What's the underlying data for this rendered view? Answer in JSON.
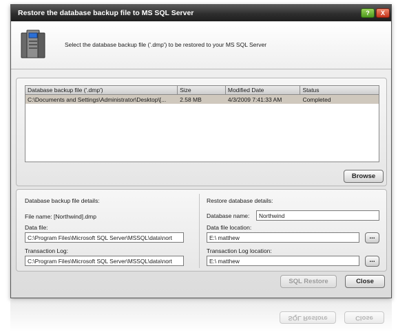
{
  "window": {
    "title": "Restore the database backup file to MS SQL Server",
    "help_glyph": "?",
    "close_glyph": "X"
  },
  "header": {
    "instruction": "Select the database backup file ('.dmp') to be restored to your MS SQL Server",
    "icon": "server-icon"
  },
  "file_list": {
    "columns": [
      "Database backup file ('.dmp')",
      "Size",
      "Modified Date",
      "Status"
    ],
    "rows": [
      {
        "file": "C:\\Documents and  Settings\\Administrator\\Desktop\\[...",
        "size": "2.58 MB",
        "modified": "4/3/2009 7:41:33 AM",
        "status": "Completed"
      }
    ]
  },
  "browse_button": {
    "label": "Browse"
  },
  "backup_details": {
    "heading": "Database backup file details:",
    "file_name": "File name: [Northwind].dmp",
    "data_file_label": "Data file:",
    "data_file_value": "C:\\Program Files\\Microsoft SQL Server\\MSSQL\\data\\nort",
    "log_label": "Transaction Log:",
    "log_value": "C:\\Program Files\\Microsoft SQL Server\\MSSQL\\data\\nort"
  },
  "restore_details": {
    "heading": "Restore database details:",
    "db_name_label": "Database name:",
    "db_name_value": "Northwind",
    "data_location_label": "Data file location:",
    "data_location_value": "E:\\ matthew",
    "log_location_label": "Transaction Log location:",
    "log_location_value": "E:\\ matthew",
    "browse_glyph": "..."
  },
  "footer": {
    "restore_label": "SQL Restore",
    "close_label": "Close"
  }
}
